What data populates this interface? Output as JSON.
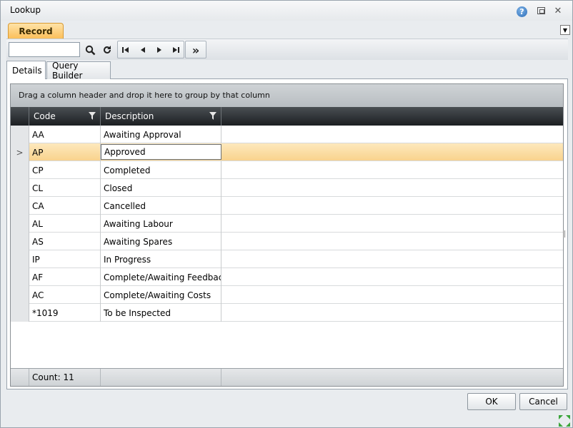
{
  "window": {
    "title": "Lookup",
    "help_label": "?",
    "close_label": "✕"
  },
  "ribbon": {
    "tab_label": "Record",
    "dropdown_label": "▼"
  },
  "toolbar": {
    "search_value": "",
    "icons": {
      "search": "search-icon",
      "refresh": "refresh-icon",
      "first": "first-record-icon",
      "prev": "previous-record-icon",
      "next": "next-record-icon",
      "last": "last-record-icon",
      "more": "expand-more-icon"
    },
    "glyphs": {
      "first": "⏮",
      "prev": "◀",
      "next": "▶",
      "last": "⏭",
      "more": "»"
    }
  },
  "tabs": [
    {
      "label": "Details",
      "active": true
    },
    {
      "label": "Query Builder",
      "active": false
    }
  ],
  "grid": {
    "group_hint": "Drag a column header and drop it here to group by that column",
    "columns": [
      {
        "label": "Code"
      },
      {
        "label": "Description"
      }
    ],
    "rows": [
      {
        "code": "AA",
        "description": "Awaiting Approval"
      },
      {
        "code": "AP",
        "description": "Approved",
        "selected": true
      },
      {
        "code": "CP",
        "description": "Completed"
      },
      {
        "code": "CL",
        "description": "Closed"
      },
      {
        "code": "CA",
        "description": "Cancelled"
      },
      {
        "code": "AL",
        "description": "Awaiting Labour"
      },
      {
        "code": "AS",
        "description": "Awaiting Spares"
      },
      {
        "code": "IP",
        "description": "In Progress"
      },
      {
        "code": "AF",
        "description": "Complete/Awaiting Feedback"
      },
      {
        "code": "AC",
        "description": "Complete/Awaiting Costs"
      },
      {
        "code": "*1019",
        "description": "To be Inspected"
      }
    ],
    "selected_indicator": ">",
    "footer_count": "Count: 11"
  },
  "buttons": {
    "ok": "OK",
    "cancel": "Cancel"
  },
  "colors": {
    "selected_row": "#f9d38d",
    "ribbon_tab": "#fbbf5a",
    "header_bg": "#1c1f22",
    "accent_blue": "#2a6cb8"
  }
}
